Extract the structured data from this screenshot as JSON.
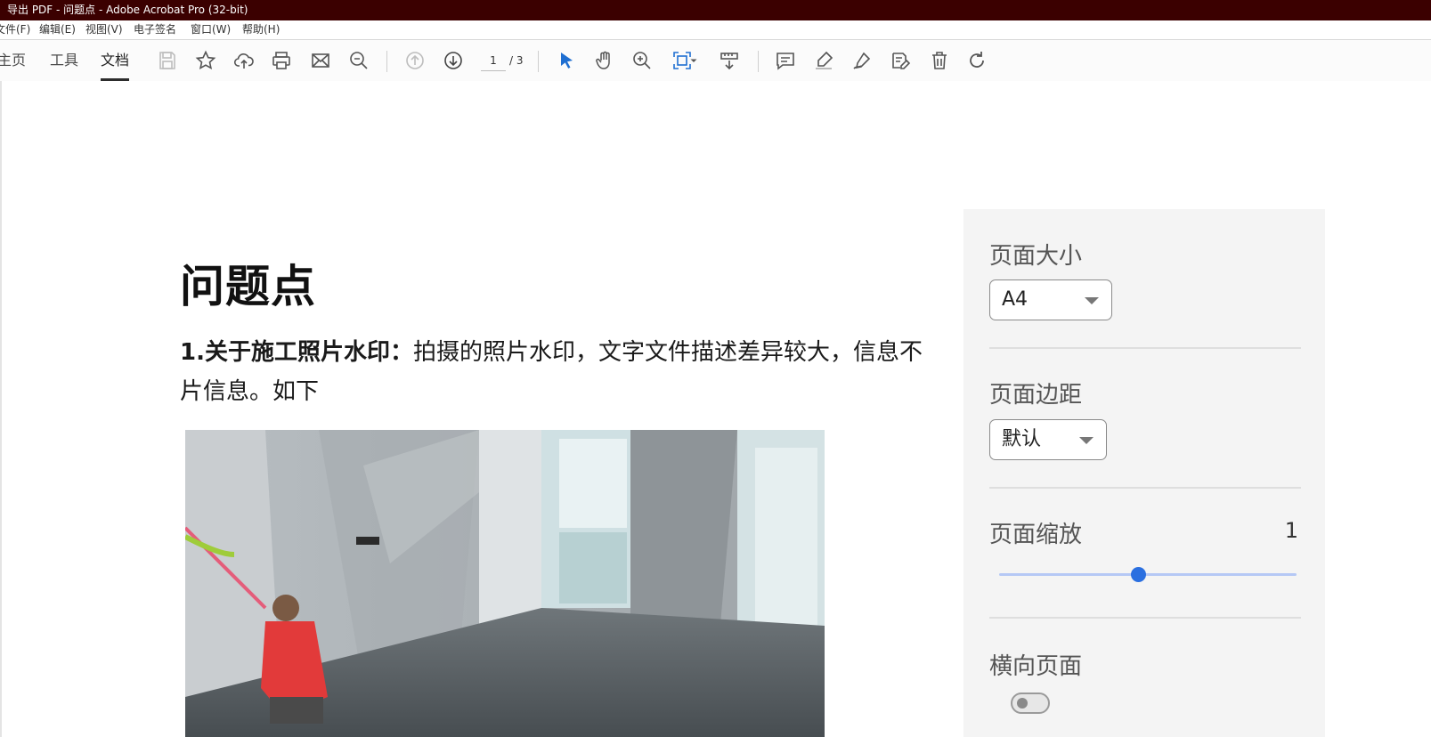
{
  "window": {
    "title": "导出 PDF - 问题点 - Adobe Acrobat Pro (32-bit)"
  },
  "menu": [
    "文件(F)",
    "编辑(E)",
    "视图(V)",
    "电子签名",
    "窗口(W)",
    "帮助(H)"
  ],
  "nav": {
    "home": "主页",
    "tools": "工具",
    "document": "文档"
  },
  "page": {
    "current": "1",
    "total": "/ 3"
  },
  "document": {
    "heading": "问题点",
    "para_bold": "1.关于施工照片水印：",
    "para_rest": "拍摄的照片水印，文字文件描述差异较大，信息不",
    "para_line2": "片信息。如下"
  },
  "panel": {
    "page_size_label": "页面大小",
    "page_size_value": "A4",
    "margins_label": "页面边距",
    "margins_value": "默认",
    "zoom_label": "页面缩放",
    "zoom_value": "1",
    "zoom_slider_fraction": 0.47,
    "landscape_label": "横向页面",
    "landscape_on": false
  },
  "colors": {
    "title_bar": "#3b0000",
    "accent": "#2a6fe0",
    "select_tool": "#1f6fd1"
  }
}
